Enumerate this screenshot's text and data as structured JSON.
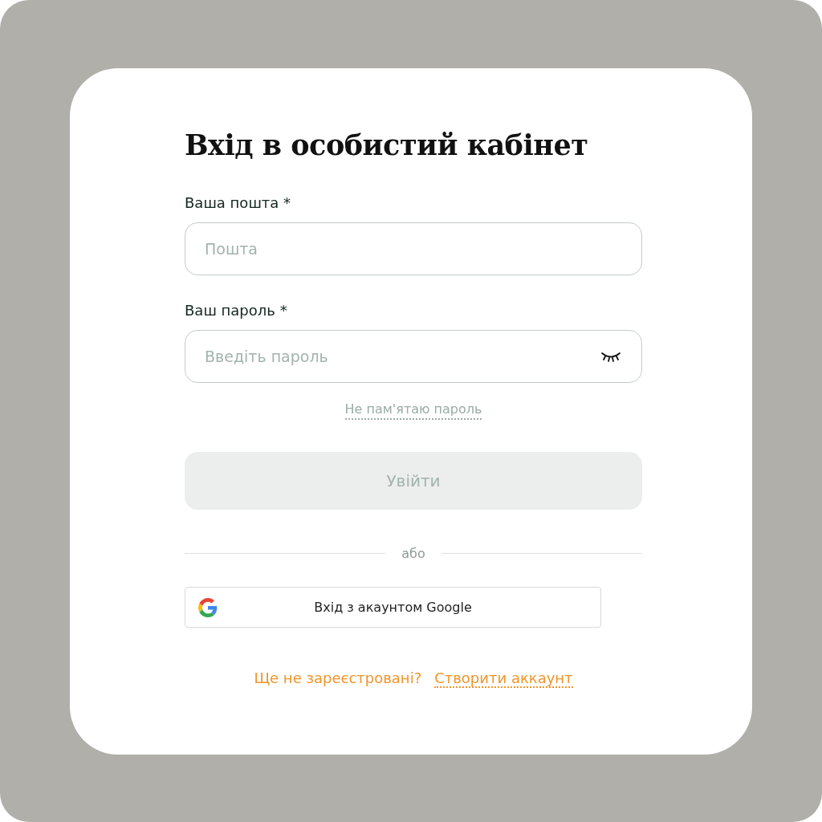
{
  "title": "Вхід в особистий кабінет",
  "fields": [
    {
      "label": "Ваша пошта *",
      "placeholder": "Пошта",
      "kind": "text"
    },
    {
      "label": "Ваш пароль *",
      "placeholder": "Введіть пароль",
      "kind": "password"
    }
  ],
  "forgot_link": "Не пам'ятаю пароль",
  "submit": {
    "label": "Увійти",
    "disabled": true
  },
  "divider": "або",
  "google_button": "Вхід з акаунтом Google",
  "footer": {
    "text": "Ще не зареєстровані?",
    "link": "Створити аккаунт"
  }
}
